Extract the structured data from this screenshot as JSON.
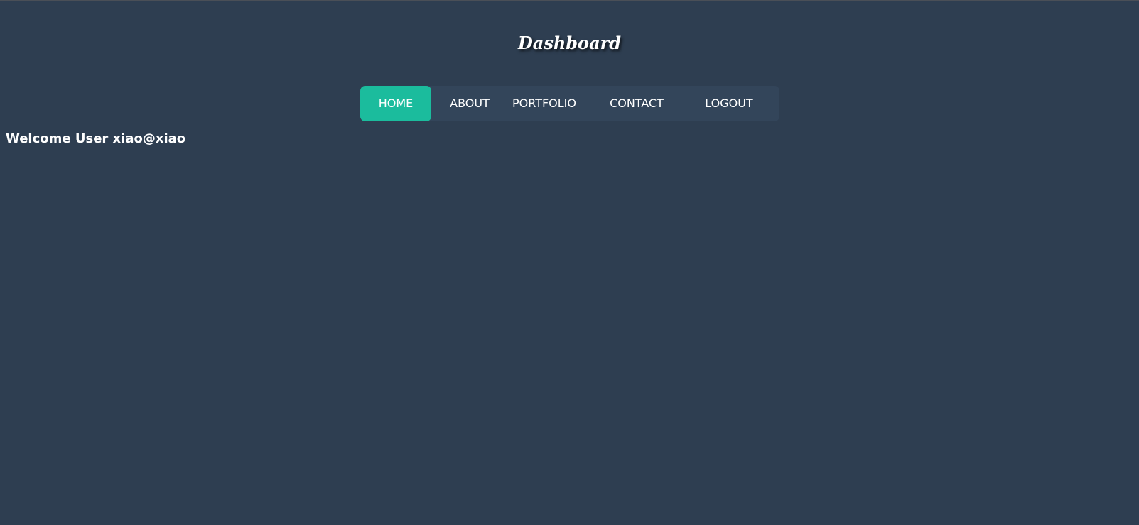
{
  "header": {
    "title": "Dashboard"
  },
  "nav": {
    "items": [
      {
        "label": "HOME",
        "active": true
      },
      {
        "label": "ABOUT",
        "active": false
      },
      {
        "label": "PORTFOLIO",
        "active": false
      },
      {
        "label": "CONTACT",
        "active": false
      },
      {
        "label": "LOGOUT",
        "active": false
      }
    ]
  },
  "main": {
    "welcome_text": "Welcome User xiao@xiao"
  },
  "colors": {
    "background": "#2e3e51",
    "nav_background": "#33455a",
    "accent": "#1bbc9d",
    "text": "#ffffff"
  }
}
